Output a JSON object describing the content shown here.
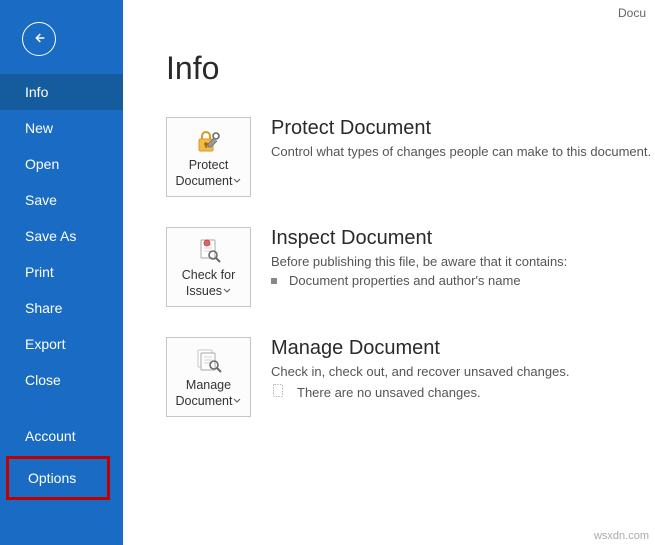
{
  "titlebar": {
    "doc_label": "Docu"
  },
  "sidebar": {
    "items": [
      {
        "label": "Info",
        "selected": true,
        "name": "nav-info"
      },
      {
        "label": "New",
        "selected": false,
        "name": "nav-new"
      },
      {
        "label": "Open",
        "selected": false,
        "name": "nav-open"
      },
      {
        "label": "Save",
        "selected": false,
        "name": "nav-save"
      },
      {
        "label": "Save As",
        "selected": false,
        "name": "nav-save-as"
      },
      {
        "label": "Print",
        "selected": false,
        "name": "nav-print"
      },
      {
        "label": "Share",
        "selected": false,
        "name": "nav-share"
      },
      {
        "label": "Export",
        "selected": false,
        "name": "nav-export"
      },
      {
        "label": "Close",
        "selected": false,
        "name": "nav-close"
      }
    ],
    "account_label": "Account",
    "options_label": "Options"
  },
  "page": {
    "title": "Info"
  },
  "protect": {
    "button_label": "Protect Document",
    "title": "Protect Document",
    "desc": "Control what types of changes people can make to this document."
  },
  "inspect": {
    "button_label": "Check for Issues",
    "title": "Inspect Document",
    "desc": "Before publishing this file, be aware that it contains:",
    "bullet": "Document properties and author's name"
  },
  "manage": {
    "button_label": "Manage Document",
    "title": "Manage Document",
    "desc": "Check in, check out, and recover unsaved changes.",
    "status": "There are no unsaved changes."
  },
  "watermark": "wsxdn.com"
}
